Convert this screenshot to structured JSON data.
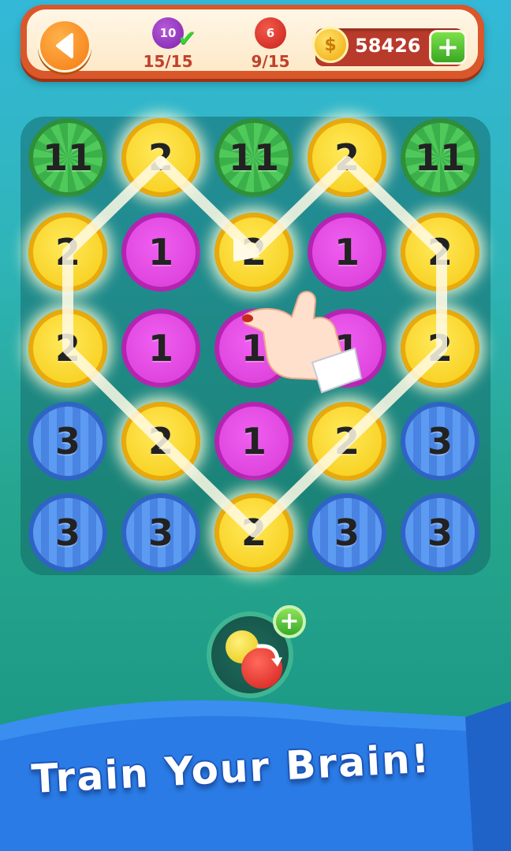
{
  "header": {
    "back_icon": "arrow-left-icon",
    "goals": [
      {
        "value": "10",
        "count": "15/15",
        "color": "#8b2fb8",
        "completed": true
      },
      {
        "value": "6",
        "count": "9/15",
        "color": "#d8342a",
        "completed": false
      }
    ],
    "coins": "58426",
    "coin_icon": "coin-icon",
    "add_label": "+"
  },
  "board": {
    "rows": [
      [
        "11",
        "2",
        "11",
        "2",
        "11"
      ],
      [
        "2",
        "1",
        "2",
        "1",
        "2"
      ],
      [
        "2",
        "1",
        "1",
        "1",
        "2"
      ],
      [
        "3",
        "2",
        "1",
        "2",
        "3"
      ],
      [
        "3",
        "3",
        "2",
        "3",
        "3"
      ]
    ]
  },
  "powerup": {
    "icon": "swap-balls-icon",
    "add_label": "+"
  },
  "slogan": "Train Your Brain!"
}
